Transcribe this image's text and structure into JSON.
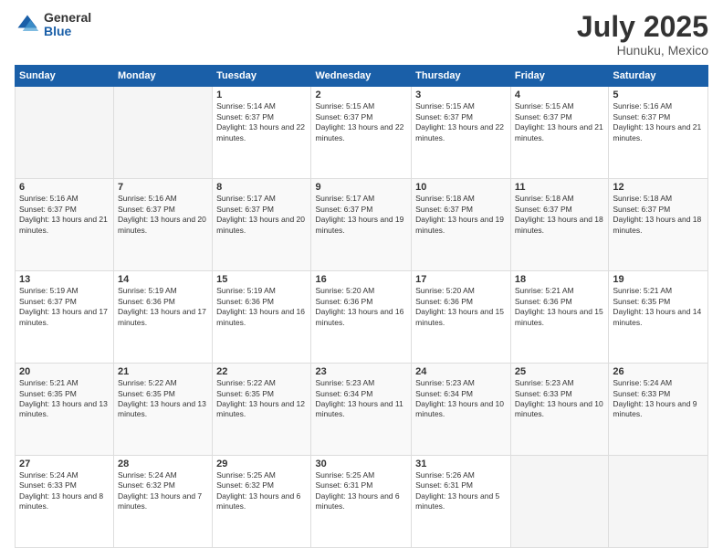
{
  "logo": {
    "general": "General",
    "blue": "Blue"
  },
  "title": "July 2025",
  "location": "Hunuku, Mexico",
  "headers": [
    "Sunday",
    "Monday",
    "Tuesday",
    "Wednesday",
    "Thursday",
    "Friday",
    "Saturday"
  ],
  "weeks": [
    [
      {
        "day": "",
        "sunrise": "",
        "sunset": "",
        "daylight": ""
      },
      {
        "day": "",
        "sunrise": "",
        "sunset": "",
        "daylight": ""
      },
      {
        "day": "1",
        "sunrise": "Sunrise: 5:14 AM",
        "sunset": "Sunset: 6:37 PM",
        "daylight": "Daylight: 13 hours and 22 minutes."
      },
      {
        "day": "2",
        "sunrise": "Sunrise: 5:15 AM",
        "sunset": "Sunset: 6:37 PM",
        "daylight": "Daylight: 13 hours and 22 minutes."
      },
      {
        "day": "3",
        "sunrise": "Sunrise: 5:15 AM",
        "sunset": "Sunset: 6:37 PM",
        "daylight": "Daylight: 13 hours and 22 minutes."
      },
      {
        "day": "4",
        "sunrise": "Sunrise: 5:15 AM",
        "sunset": "Sunset: 6:37 PM",
        "daylight": "Daylight: 13 hours and 21 minutes."
      },
      {
        "day": "5",
        "sunrise": "Sunrise: 5:16 AM",
        "sunset": "Sunset: 6:37 PM",
        "daylight": "Daylight: 13 hours and 21 minutes."
      }
    ],
    [
      {
        "day": "6",
        "sunrise": "Sunrise: 5:16 AM",
        "sunset": "Sunset: 6:37 PM",
        "daylight": "Daylight: 13 hours and 21 minutes."
      },
      {
        "day": "7",
        "sunrise": "Sunrise: 5:16 AM",
        "sunset": "Sunset: 6:37 PM",
        "daylight": "Daylight: 13 hours and 20 minutes."
      },
      {
        "day": "8",
        "sunrise": "Sunrise: 5:17 AM",
        "sunset": "Sunset: 6:37 PM",
        "daylight": "Daylight: 13 hours and 20 minutes."
      },
      {
        "day": "9",
        "sunrise": "Sunrise: 5:17 AM",
        "sunset": "Sunset: 6:37 PM",
        "daylight": "Daylight: 13 hours and 19 minutes."
      },
      {
        "day": "10",
        "sunrise": "Sunrise: 5:18 AM",
        "sunset": "Sunset: 6:37 PM",
        "daylight": "Daylight: 13 hours and 19 minutes."
      },
      {
        "day": "11",
        "sunrise": "Sunrise: 5:18 AM",
        "sunset": "Sunset: 6:37 PM",
        "daylight": "Daylight: 13 hours and 18 minutes."
      },
      {
        "day": "12",
        "sunrise": "Sunrise: 5:18 AM",
        "sunset": "Sunset: 6:37 PM",
        "daylight": "Daylight: 13 hours and 18 minutes."
      }
    ],
    [
      {
        "day": "13",
        "sunrise": "Sunrise: 5:19 AM",
        "sunset": "Sunset: 6:37 PM",
        "daylight": "Daylight: 13 hours and 17 minutes."
      },
      {
        "day": "14",
        "sunrise": "Sunrise: 5:19 AM",
        "sunset": "Sunset: 6:36 PM",
        "daylight": "Daylight: 13 hours and 17 minutes."
      },
      {
        "day": "15",
        "sunrise": "Sunrise: 5:19 AM",
        "sunset": "Sunset: 6:36 PM",
        "daylight": "Daylight: 13 hours and 16 minutes."
      },
      {
        "day": "16",
        "sunrise": "Sunrise: 5:20 AM",
        "sunset": "Sunset: 6:36 PM",
        "daylight": "Daylight: 13 hours and 16 minutes."
      },
      {
        "day": "17",
        "sunrise": "Sunrise: 5:20 AM",
        "sunset": "Sunset: 6:36 PM",
        "daylight": "Daylight: 13 hours and 15 minutes."
      },
      {
        "day": "18",
        "sunrise": "Sunrise: 5:21 AM",
        "sunset": "Sunset: 6:36 PM",
        "daylight": "Daylight: 13 hours and 15 minutes."
      },
      {
        "day": "19",
        "sunrise": "Sunrise: 5:21 AM",
        "sunset": "Sunset: 6:35 PM",
        "daylight": "Daylight: 13 hours and 14 minutes."
      }
    ],
    [
      {
        "day": "20",
        "sunrise": "Sunrise: 5:21 AM",
        "sunset": "Sunset: 6:35 PM",
        "daylight": "Daylight: 13 hours and 13 minutes."
      },
      {
        "day": "21",
        "sunrise": "Sunrise: 5:22 AM",
        "sunset": "Sunset: 6:35 PM",
        "daylight": "Daylight: 13 hours and 13 minutes."
      },
      {
        "day": "22",
        "sunrise": "Sunrise: 5:22 AM",
        "sunset": "Sunset: 6:35 PM",
        "daylight": "Daylight: 13 hours and 12 minutes."
      },
      {
        "day": "23",
        "sunrise": "Sunrise: 5:23 AM",
        "sunset": "Sunset: 6:34 PM",
        "daylight": "Daylight: 13 hours and 11 minutes."
      },
      {
        "day": "24",
        "sunrise": "Sunrise: 5:23 AM",
        "sunset": "Sunset: 6:34 PM",
        "daylight": "Daylight: 13 hours and 10 minutes."
      },
      {
        "day": "25",
        "sunrise": "Sunrise: 5:23 AM",
        "sunset": "Sunset: 6:33 PM",
        "daylight": "Daylight: 13 hours and 10 minutes."
      },
      {
        "day": "26",
        "sunrise": "Sunrise: 5:24 AM",
        "sunset": "Sunset: 6:33 PM",
        "daylight": "Daylight: 13 hours and 9 minutes."
      }
    ],
    [
      {
        "day": "27",
        "sunrise": "Sunrise: 5:24 AM",
        "sunset": "Sunset: 6:33 PM",
        "daylight": "Daylight: 13 hours and 8 minutes."
      },
      {
        "day": "28",
        "sunrise": "Sunrise: 5:24 AM",
        "sunset": "Sunset: 6:32 PM",
        "daylight": "Daylight: 13 hours and 7 minutes."
      },
      {
        "day": "29",
        "sunrise": "Sunrise: 5:25 AM",
        "sunset": "Sunset: 6:32 PM",
        "daylight": "Daylight: 13 hours and 6 minutes."
      },
      {
        "day": "30",
        "sunrise": "Sunrise: 5:25 AM",
        "sunset": "Sunset: 6:31 PM",
        "daylight": "Daylight: 13 hours and 6 minutes."
      },
      {
        "day": "31",
        "sunrise": "Sunrise: 5:26 AM",
        "sunset": "Sunset: 6:31 PM",
        "daylight": "Daylight: 13 hours and 5 minutes."
      },
      {
        "day": "",
        "sunrise": "",
        "sunset": "",
        "daylight": ""
      },
      {
        "day": "",
        "sunrise": "",
        "sunset": "",
        "daylight": ""
      }
    ]
  ]
}
